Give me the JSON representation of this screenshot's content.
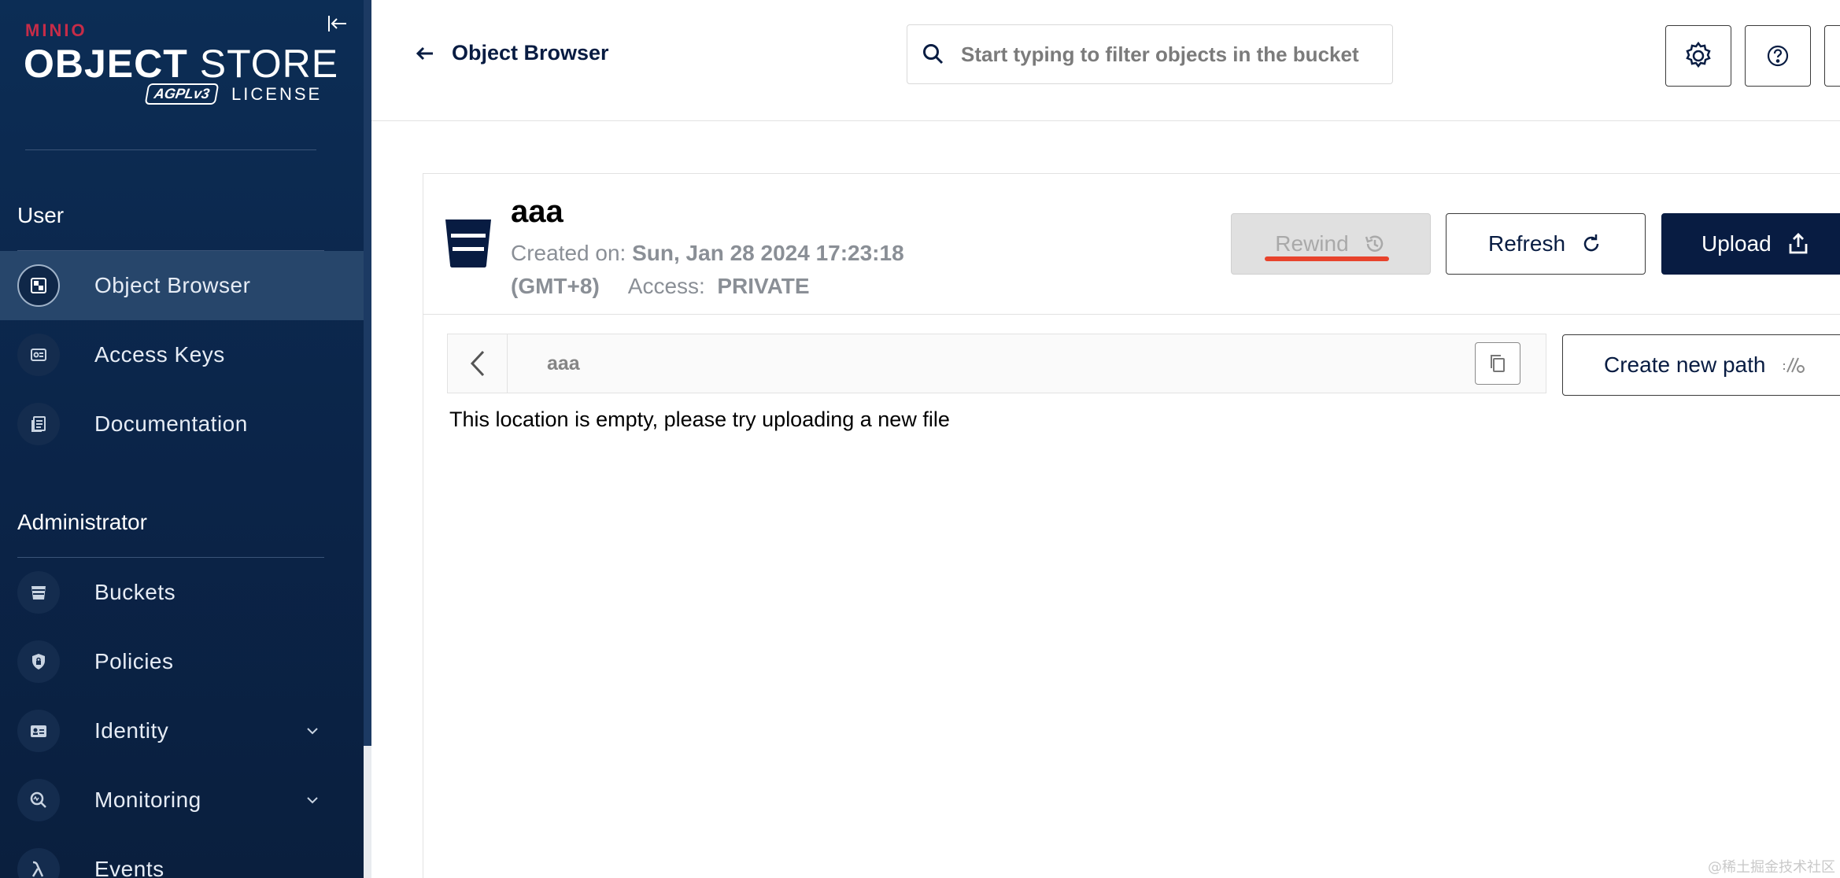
{
  "brand": {
    "top": "MINIO",
    "main_bold": "OBJECT",
    "main_light": "STORE",
    "badge": "AGPLv3",
    "license": "LICENSE"
  },
  "sidebar": {
    "user_section": "User",
    "admin_section": "Administrator",
    "user_items": [
      {
        "label": "Object Browser",
        "icon": "object-browser-icon",
        "active": true
      },
      {
        "label": "Access Keys",
        "icon": "access-keys-icon"
      },
      {
        "label": "Documentation",
        "icon": "documentation-icon"
      }
    ],
    "admin_items": [
      {
        "label": "Buckets",
        "icon": "bucket-icon"
      },
      {
        "label": "Policies",
        "icon": "policy-shield-icon"
      },
      {
        "label": "Identity",
        "icon": "identity-card-icon",
        "expandable": true
      },
      {
        "label": "Monitoring",
        "icon": "monitoring-icon",
        "expandable": true
      },
      {
        "label": "Events",
        "icon": "lambda-icon"
      }
    ]
  },
  "header": {
    "back_label": "Object Browser",
    "search_placeholder": "Start typing to filter objects in the bucket"
  },
  "bucket": {
    "name": "aaa",
    "created_label": "Created on:",
    "created_value": "Sun, Jan 28 2024 17:23:18",
    "timezone": "(GMT+8)",
    "access_label": "Access:",
    "access_value": "PRIVATE",
    "rewind_label": "Rewind",
    "refresh_label": "Refresh",
    "upload_label": "Upload"
  },
  "browser": {
    "path": "aaa",
    "create_path_label": "Create new path",
    "empty_message": "This location is empty, please try uploading a new file"
  },
  "watermark": "@稀土掘金技术社区",
  "colors": {
    "sidebar_bg": "#0b2448",
    "primary": "#081c42",
    "accent_red": "#c72c48",
    "underline": "#e8432c"
  }
}
